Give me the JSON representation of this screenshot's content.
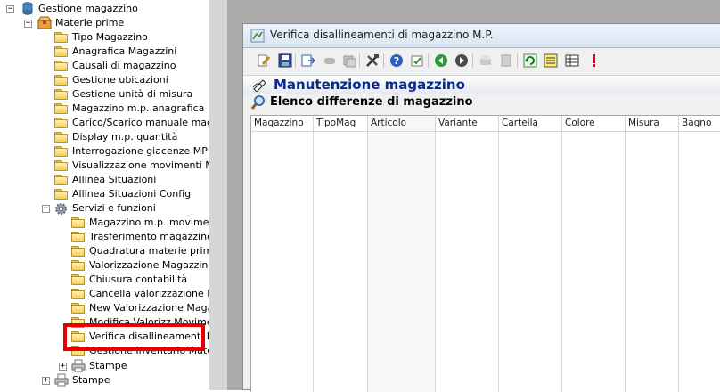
{
  "tree": {
    "root": {
      "label": "Gestione magazzino",
      "expander": "−"
    },
    "materie_prime": {
      "label": "Materie prime",
      "expander": "−"
    },
    "mp_items": [
      "Tipo Magazzino",
      "Anagrafica Magazzini",
      "Causali di magazzino",
      "Gestione ubicazioni",
      "Gestione unità di misura",
      "Magazzino m.p. anagrafica",
      "Carico/Scarico manuale magazzi",
      "Display m.p. quantità",
      "Interrogazione giacenze MP",
      "Visualizzazione movimenti M.P.",
      "Allinea Situazioni",
      "Allinea Situazioni Config"
    ],
    "servizi": {
      "label": "Servizi e funzioni",
      "expander": "−"
    },
    "servizi_items": [
      "Magazzino m.p. movimenti",
      "Trasferimento magazzino m",
      "Quadratura materie prime",
      "Valorizzazione Magazzino m",
      "Chiusura contabilità",
      "Cancella valorizzazione Mag",
      "New Valorizzazione Magazzi",
      "Modifica Valorizz Movimenti",
      "Verifica disallineamenti MP",
      "Gestione Inventario Materie"
    ],
    "stampe_inner": {
      "label": "Stampe",
      "expander": "+"
    },
    "stampe_outer": {
      "label": "Stampe",
      "expander": "+"
    }
  },
  "window": {
    "title": "Verifica disallineamenti di magazzino M.P.",
    "header_title": "Manutenzione magazzino",
    "section_title": "Elenco differenze di magazzino"
  },
  "toolbar": {
    "icons": [
      "edit-icon",
      "save-icon",
      "export-icon",
      "disabled-icon",
      "disabled-copy-icon",
      "tools-icon",
      "help-icon",
      "refresh-check-icon",
      "prev-icon",
      "next-icon",
      "disabled-print-icon",
      "disabled-doc-icon",
      "refresh-icon",
      "list-icon",
      "table-icon",
      "alert-icon"
    ]
  },
  "grid": {
    "columns": [
      "Magazzino",
      "TipoMag",
      "Articolo",
      "Variante",
      "Cartella",
      "Colore",
      "Misura",
      "Bagno"
    ],
    "rows": []
  },
  "colors": {
    "header_title": "#0b2a8e",
    "highlight_border": "#e60000",
    "workspace": "#ababab"
  }
}
